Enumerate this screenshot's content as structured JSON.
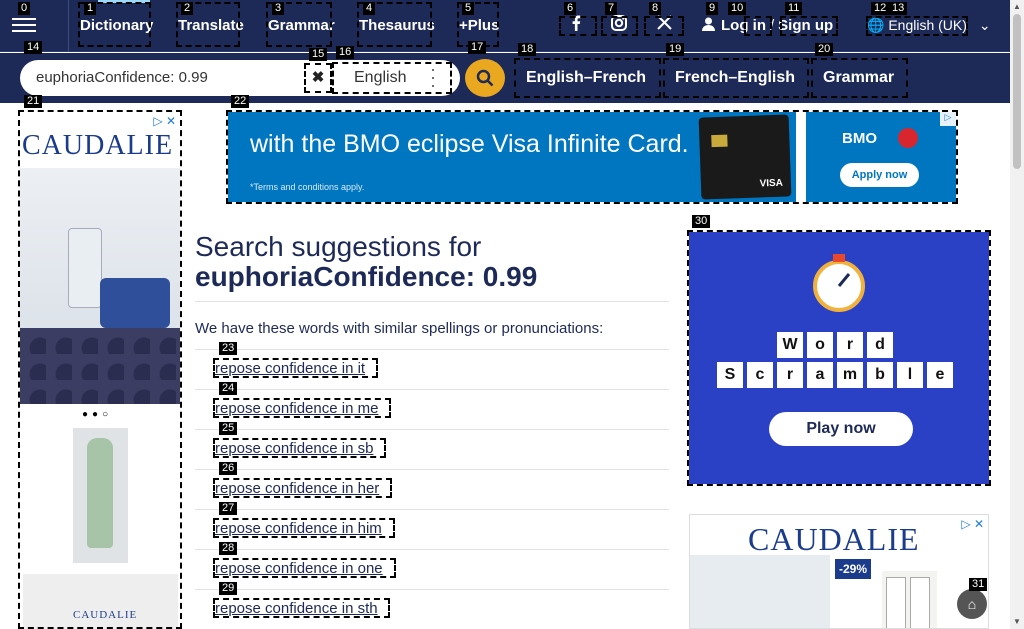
{
  "header": {
    "nav": [
      "Dictionary",
      "Translate",
      "Grammar",
      "Thesaurus",
      "+Plus"
    ],
    "login": "Log in",
    "slash": "/",
    "signup": "Sign up",
    "language": "English (UK)"
  },
  "search": {
    "value": "euphoriaConfidence: 0.99",
    "dictionary": "English"
  },
  "subnav": [
    "English–French",
    "French–English",
    "Grammar"
  ],
  "main": {
    "heading_prefix": "Search suggestions for",
    "heading_term": "euphoriaConfidence: 0.99",
    "intro": "We have these words with similar spellings or pronunciations:",
    "suggestions": [
      "repose confidence in it",
      "repose confidence in me",
      "repose confidence in sb",
      "repose confidence in her",
      "repose confidence in him",
      "repose confidence in one",
      "repose confidence in sth"
    ]
  },
  "ads": {
    "left_brand": "CAUDALIE",
    "top_text": "with the BMO eclipse Visa Infinite Card.",
    "top_small": "*Terms and conditions apply.",
    "top_brand": "BMO",
    "top_cta": "Apply now",
    "game_row1": [
      "W",
      "o",
      "r",
      "d"
    ],
    "game_row2": [
      "S",
      "c",
      "r",
      "a",
      "m",
      "b",
      "l",
      "e"
    ],
    "game_cta": "Play now",
    "right_brand": "CAUDALIE",
    "right_discount": "-29%"
  },
  "tags": [
    "0",
    "1",
    "2",
    "3",
    "4",
    "5",
    "6",
    "7",
    "8",
    "9",
    "10",
    "11",
    "12",
    "13",
    "14",
    "15",
    "16",
    "17",
    "18",
    "19",
    "20",
    "21",
    "22",
    "23",
    "24",
    "25",
    "26",
    "27",
    "28",
    "29",
    "30",
    "31"
  ],
  "colors": {
    "header_bg": "#1d2a57",
    "search_button": "#e9a820",
    "accent": "#9ad9f7"
  }
}
